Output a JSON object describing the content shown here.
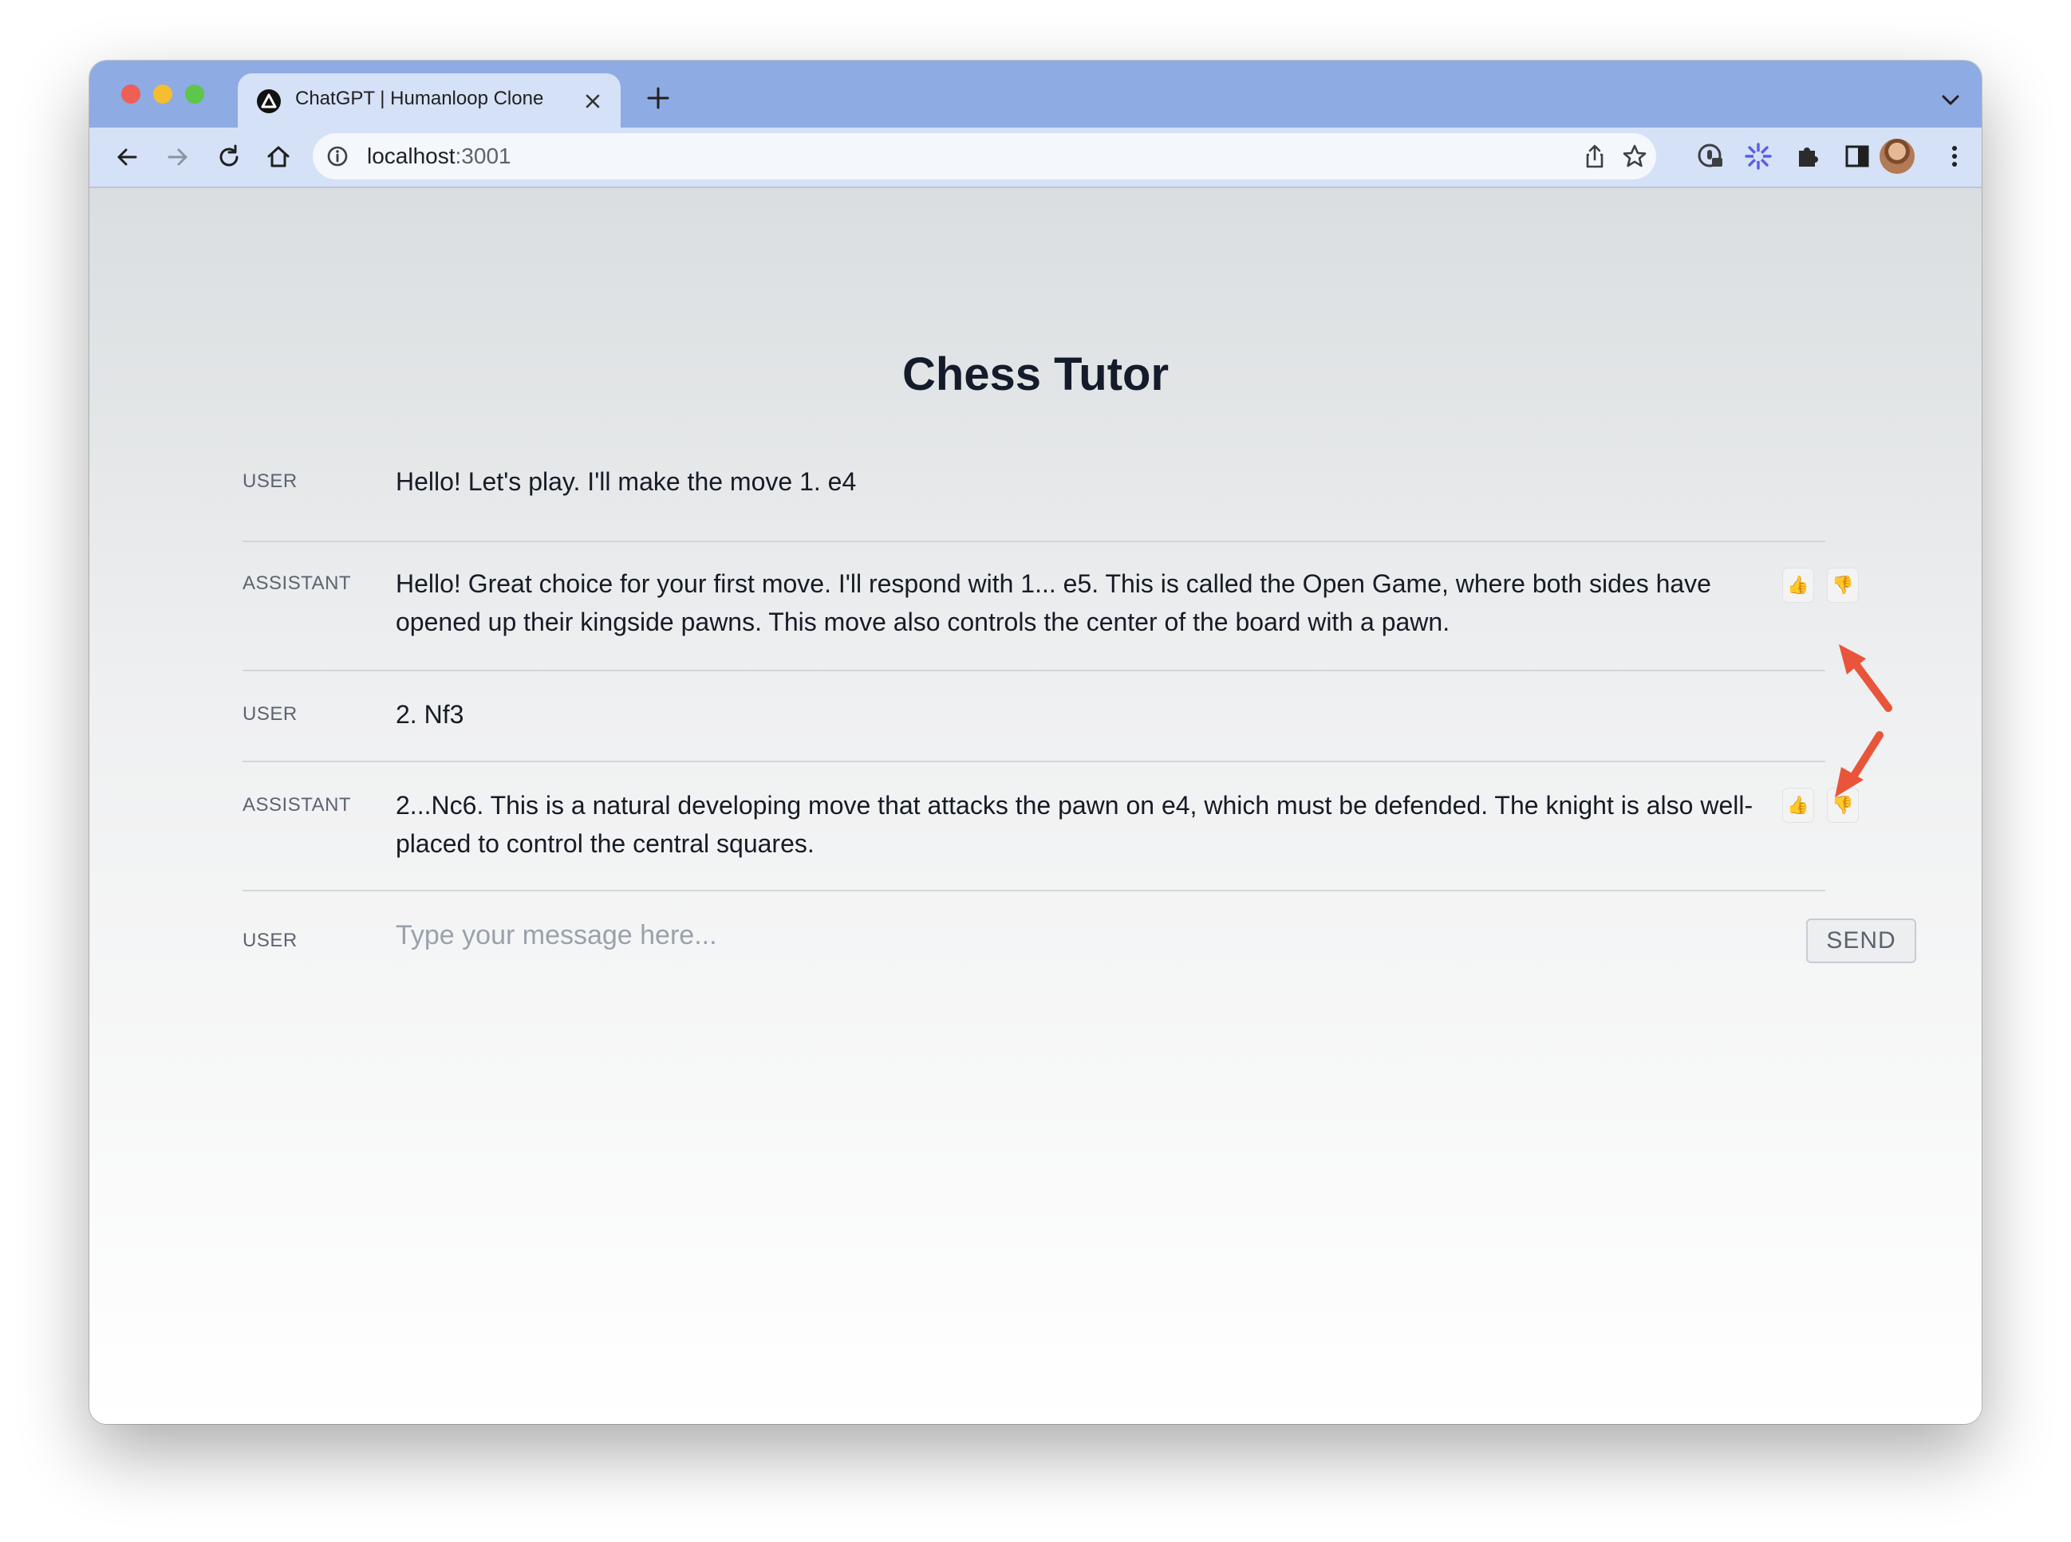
{
  "browser": {
    "tab_title": "ChatGPT | Humanloop Clone",
    "url_host": "localhost",
    "url_port": ":3001",
    "accent_color": "#8eabe3"
  },
  "page": {
    "title": "Chess Tutor"
  },
  "messages": [
    {
      "role": "USER",
      "text": "Hello! Let's play. I'll make the move 1. e4"
    },
    {
      "role": "ASSISTANT",
      "text": "Hello! Great choice for your first move. I'll respond with 1... e5. This is called the Open Game, where both sides have opened up their kingside pawns. This move also controls the center of the board with a pawn.",
      "feedback": {
        "up": "👍",
        "down": "👎"
      }
    },
    {
      "role": "USER",
      "text": "2. Nf3"
    },
    {
      "role": "ASSISTANT",
      "text": "2...Nc6. This is a natural developing move that attacks the pawn on e4, which must be defended. The knight is also well-placed to control the central squares.",
      "feedback": {
        "up": "👍",
        "down": "👎"
      }
    }
  ],
  "composer": {
    "role": "USER",
    "placeholder": "Type your message here...",
    "send_label": "SEND"
  },
  "annotation_color": "#e8553a"
}
